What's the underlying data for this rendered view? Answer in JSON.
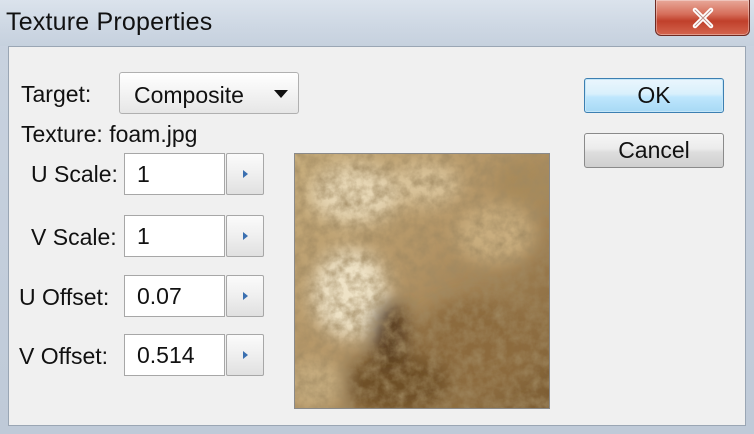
{
  "window": {
    "title": "Texture Properties"
  },
  "dialog": {
    "target_label": "Target:",
    "target_value": "Composite",
    "texture_label": "Texture: foam.jpg",
    "fields": [
      {
        "label": "U Scale:",
        "value": "1"
      },
      {
        "label": "V Scale:",
        "value": "1"
      },
      {
        "label": "U Offset:",
        "value": "0.07"
      },
      {
        "label": "V Offset:",
        "value": "0.514"
      }
    ],
    "ok_label": "OK",
    "cancel_label": "Cancel"
  },
  "icons": {
    "close": "close-icon",
    "dropdown": "chevron-down-icon",
    "spin": "chevron-right-icon"
  },
  "colors": {
    "ok_border": "#3c7fb1",
    "close_red": "#c0402b"
  }
}
